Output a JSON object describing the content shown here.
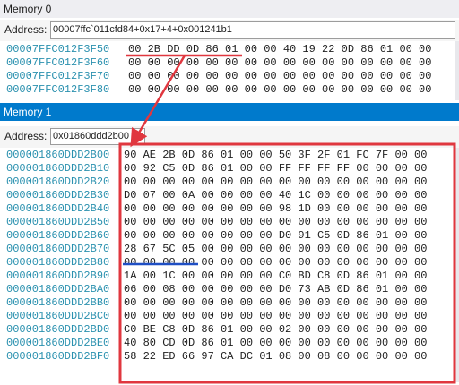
{
  "memory0": {
    "title": "Memory 0",
    "address_label": "Address:",
    "address_value": "00007ffc`011cfd84+0x17+4+0x001241b1",
    "rows": [
      {
        "addr": "00007FFC012F3F50",
        "bytes": "00 2B DD 0D 86 01 00 00 40 19 22 0D 86 01 00 00"
      },
      {
        "addr": "00007FFC012F3F60",
        "bytes": "00 00 00 00 00 00 00 00 00 00 00 00 00 00 00 00"
      },
      {
        "addr": "00007FFC012F3F70",
        "bytes": "00 00 00 00 00 00 00 00 00 00 00 00 00 00 00 00"
      },
      {
        "addr": "00007FFC012F3F80",
        "bytes": "00 00 00 00 00 00 00 00 00 00 00 00 00 00 00 00"
      }
    ]
  },
  "memory1": {
    "title": "Memory 1",
    "address_label": "Address:",
    "address_value": "0x01860ddd2b00",
    "rows": [
      {
        "addr": "000001860DDD2B00",
        "bytes": "90 AE 2B 0D 86 01 00 00 50 3F 2F 01 FC 7F 00 00"
      },
      {
        "addr": "000001860DDD2B10",
        "bytes": "00 92 C5 0D 86 01 00 00 FF FF FF FF 00 00 00 00"
      },
      {
        "addr": "000001860DDD2B20",
        "bytes": "00 00 00 00 00 00 00 00 00 00 00 00 00 00 00 00"
      },
      {
        "addr": "000001860DDD2B30",
        "bytes": "D0 07 00 0A 00 00 00 00 40 1C 00 00 00 00 00 00"
      },
      {
        "addr": "000001860DDD2B40",
        "bytes": "00 00 00 00 00 00 00 00 98 1D 00 00 00 00 00 00"
      },
      {
        "addr": "000001860DDD2B50",
        "bytes": "00 00 00 00 00 00 00 00 00 00 00 00 00 00 00 00"
      },
      {
        "addr": "000001860DDD2B60",
        "bytes": "00 00 00 00 00 00 00 00 D0 91 C5 0D 86 01 00 00"
      },
      {
        "addr": "000001860DDD2B70",
        "bytes": "28 67 5C 05 00 00 00 00 00 00 00 00 00 00 00 00"
      },
      {
        "addr": "000001860DDD2B80",
        "bytes": "00 00 00 00 00 00 00 00 00 00 00 00 00 00 00 00"
      },
      {
        "addr": "000001860DDD2B90",
        "bytes": "1A 00 1C 00 00 00 00 00 C0 BD C8 0D 86 01 00 00"
      },
      {
        "addr": "000001860DDD2BA0",
        "bytes": "06 00 08 00 00 00 00 00 D0 73 AB 0D 86 01 00 00"
      },
      {
        "addr": "000001860DDD2BB0",
        "bytes": "00 00 00 00 00 00 00 00 00 00 00 00 00 00 00 00"
      },
      {
        "addr": "000001860DDD2BC0",
        "bytes": "00 00 00 00 00 00 00 00 00 00 00 00 00 00 00 00"
      },
      {
        "addr": "000001860DDD2BD0",
        "bytes": "C0 BE C8 0D 86 01 00 00 02 00 00 00 00 00 00 00"
      },
      {
        "addr": "000001860DDD2BE0",
        "bytes": "40 80 CD 0D 86 01 00 00 00 00 00 00 00 00 00 00"
      },
      {
        "addr": "000001860DDD2BF0",
        "bytes": "58 22 ED 66 97 CA DC 01 08 00 08 00 00 00 00 00"
      }
    ]
  },
  "colors": {
    "address_text": "#2b91af",
    "active_title": "#007acc",
    "annotation_red": "#e0373f",
    "annotation_blue": "#1f4fc4"
  }
}
